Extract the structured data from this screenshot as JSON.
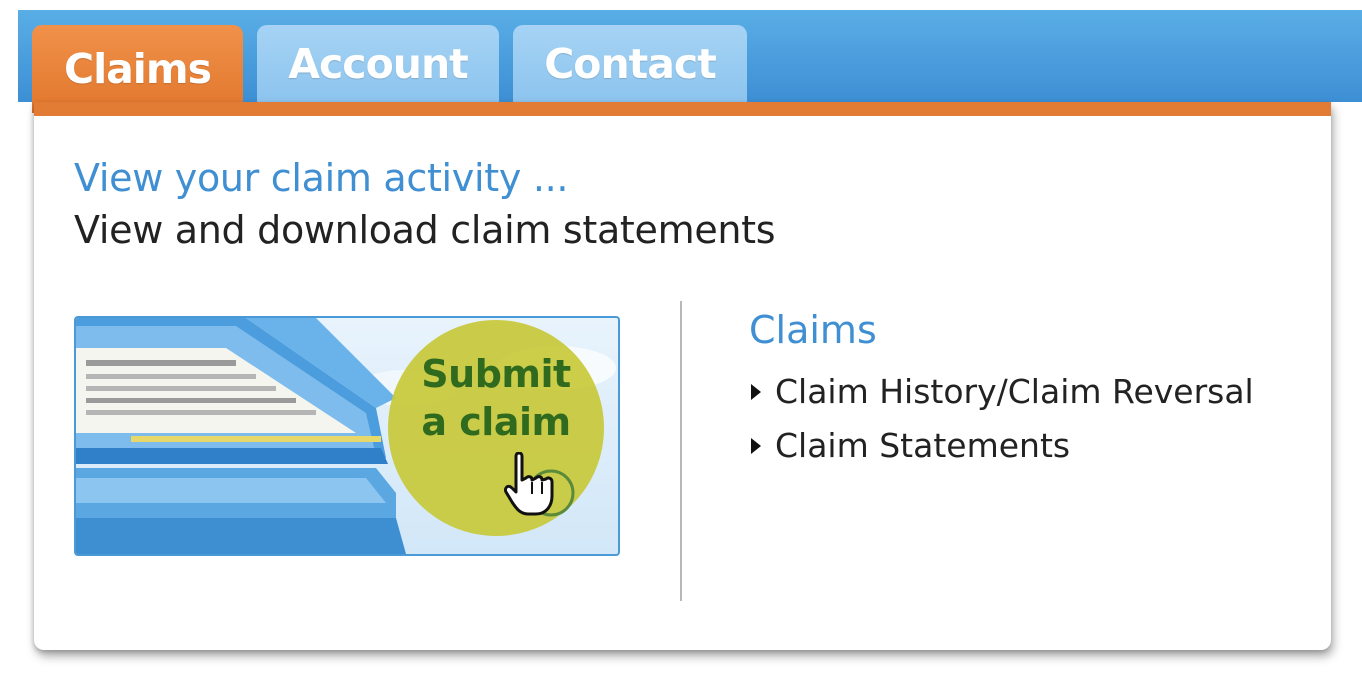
{
  "tabs": {
    "claims": "Claims",
    "account": "Account",
    "contact": "Contact"
  },
  "panel": {
    "headline": "View your claim activity ...",
    "subhead": "View and download claim statements"
  },
  "promo": {
    "line1": "Submit",
    "line2": "a claim",
    "icon": "hand-cursor-icon"
  },
  "links": {
    "title": "Claims",
    "items": [
      {
        "label": "Claim History/Claim Reversal"
      },
      {
        "label": "Claim Statements"
      }
    ]
  },
  "colors": {
    "active_tab": "#e27b33",
    "inactive_tab": "#a6d3f4",
    "topbar": "#4a9ddf",
    "link_blue": "#3f8fd2",
    "promo_circle": "#c8c93a",
    "promo_text": "#2f6a1e"
  }
}
